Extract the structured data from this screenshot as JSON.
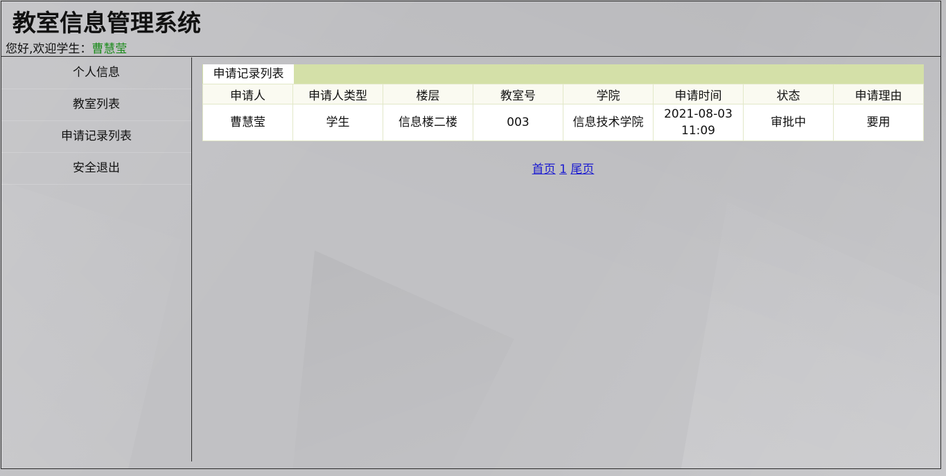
{
  "header": {
    "title": "教室信息管理系统",
    "welcome_prefix": "您好,欢迎学生：",
    "user_name": "曹慧莹"
  },
  "sidebar": {
    "items": [
      {
        "label": "个人信息"
      },
      {
        "label": "教室列表"
      },
      {
        "label": "申请记录列表"
      },
      {
        "label": "安全退出"
      }
    ]
  },
  "main": {
    "table_title": "申请记录列表",
    "columns": [
      "申请人",
      "申请人类型",
      "楼层",
      "教室号",
      "学院",
      "申请时间",
      "状态",
      "申请理由"
    ],
    "rows": [
      [
        "曹慧莹",
        "学生",
        "信息楼二楼",
        "003",
        "信息技术学院",
        "2021-08-03 11:09",
        "审批中",
        "要用"
      ]
    ],
    "pagination": {
      "first": "首页",
      "page": "1",
      "last": "尾页"
    }
  },
  "colors": {
    "background": "#c1c1c4",
    "title_bar": "#d4e0a8",
    "user_name": "#1c8b1c",
    "link": "#1a1ad0"
  }
}
